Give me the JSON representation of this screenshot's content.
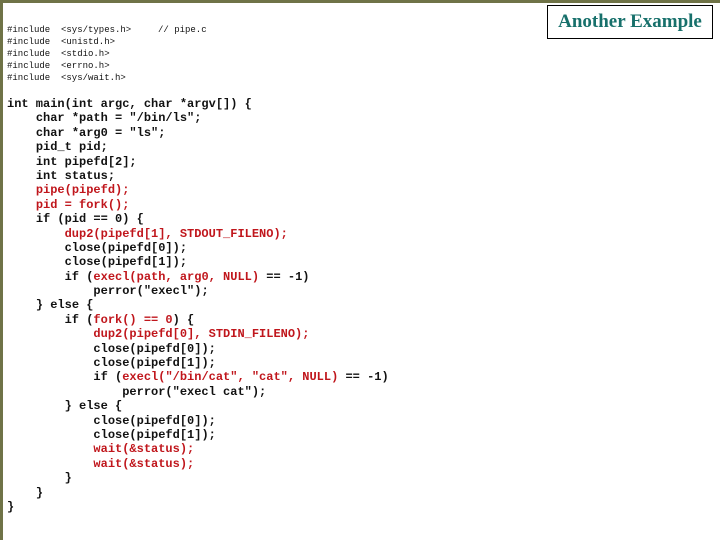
{
  "slide": {
    "title": "Another Example",
    "colors": {
      "frame": "#6f7347",
      "title": "#17706b",
      "code_text": "#111111",
      "highlight": "#c0161c"
    }
  },
  "includes": [
    {
      "directive": "#include",
      "header": "<sys/types.h>",
      "comment": "// pipe.c"
    },
    {
      "directive": "#include",
      "header": "<unistd.h>",
      "comment": ""
    },
    {
      "directive": "#include",
      "header": "<stdio.h>",
      "comment": ""
    },
    {
      "directive": "#include",
      "header": "<errno.h>",
      "comment": ""
    },
    {
      "directive": "#include",
      "header": "<sys/wait.h>",
      "comment": ""
    }
  ],
  "code": [
    {
      "indent": 0,
      "segments": [
        {
          "text": "int main(int argc, char *argv[]) {",
          "red": false
        }
      ]
    },
    {
      "indent": 1,
      "segments": [
        {
          "text": "char *path = \"/bin/ls\";",
          "red": false
        }
      ]
    },
    {
      "indent": 1,
      "segments": [
        {
          "text": "char *arg0 = \"ls\";",
          "red": false
        }
      ]
    },
    {
      "indent": 1,
      "segments": [
        {
          "text": "pid_t pid;",
          "red": false
        }
      ]
    },
    {
      "indent": 1,
      "segments": [
        {
          "text": "int pipefd[2];",
          "red": false
        }
      ]
    },
    {
      "indent": 1,
      "segments": [
        {
          "text": "int status;",
          "red": false
        }
      ]
    },
    {
      "indent": 1,
      "segments": [
        {
          "text": "pipe(pipefd);",
          "red": true
        }
      ]
    },
    {
      "indent": 1,
      "segments": [
        {
          "text": "pid = fork();",
          "red": true
        }
      ]
    },
    {
      "indent": 1,
      "segments": [
        {
          "text": "if (pid == 0) {",
          "red": false
        }
      ]
    },
    {
      "indent": 2,
      "segments": [
        {
          "text": "dup2(pipefd[1], STDOUT_FILENO);",
          "red": true
        }
      ]
    },
    {
      "indent": 2,
      "segments": [
        {
          "text": "close(pipefd[0]);",
          "red": false
        }
      ]
    },
    {
      "indent": 2,
      "segments": [
        {
          "text": "close(pipefd[1]);",
          "red": false
        }
      ]
    },
    {
      "indent": 2,
      "segments": [
        {
          "text": "if (",
          "red": false
        },
        {
          "text": "execl(path, arg0, NULL)",
          "red": true
        },
        {
          "text": " == -1)",
          "red": false
        }
      ]
    },
    {
      "indent": 3,
      "segments": [
        {
          "text": "perror(\"execl\");",
          "red": false
        }
      ]
    },
    {
      "indent": 1,
      "segments": [
        {
          "text": "} else {",
          "red": false
        }
      ]
    },
    {
      "indent": 2,
      "segments": [
        {
          "text": "if (",
          "red": false
        },
        {
          "text": "fork() == 0",
          "red": true
        },
        {
          "text": ") {",
          "red": false
        }
      ]
    },
    {
      "indent": 3,
      "segments": [
        {
          "text": "dup2(pipefd[0], STDIN_FILENO);",
          "red": true
        }
      ]
    },
    {
      "indent": 3,
      "segments": [
        {
          "text": "close(pipefd[0]);",
          "red": false
        }
      ]
    },
    {
      "indent": 3,
      "segments": [
        {
          "text": "close(pipefd[1]);",
          "red": false
        }
      ]
    },
    {
      "indent": 3,
      "segments": [
        {
          "text": "if (",
          "red": false
        },
        {
          "text": "execl(\"/bin/cat\", \"cat\", NULL)",
          "red": true
        },
        {
          "text": " == -1)",
          "red": false
        }
      ]
    },
    {
      "indent": 4,
      "segments": [
        {
          "text": "perror(\"execl cat\");",
          "red": false
        }
      ]
    },
    {
      "indent": 2,
      "segments": [
        {
          "text": "} else {",
          "red": false
        }
      ]
    },
    {
      "indent": 3,
      "segments": [
        {
          "text": "close(pipefd[0]);",
          "red": false
        }
      ]
    },
    {
      "indent": 3,
      "segments": [
        {
          "text": "close(pipefd[1]);",
          "red": false
        }
      ]
    },
    {
      "indent": 3,
      "segments": [
        {
          "text": "wait(&status);",
          "red": true
        }
      ]
    },
    {
      "indent": 3,
      "segments": [
        {
          "text": "wait(&status);",
          "red": true
        }
      ]
    },
    {
      "indent": 2,
      "segments": [
        {
          "text": "}",
          "red": false
        }
      ]
    },
    {
      "indent": 1,
      "segments": [
        {
          "text": "}",
          "red": false
        }
      ]
    },
    {
      "indent": 0,
      "segments": [
        {
          "text": "}",
          "red": false
        }
      ]
    }
  ]
}
